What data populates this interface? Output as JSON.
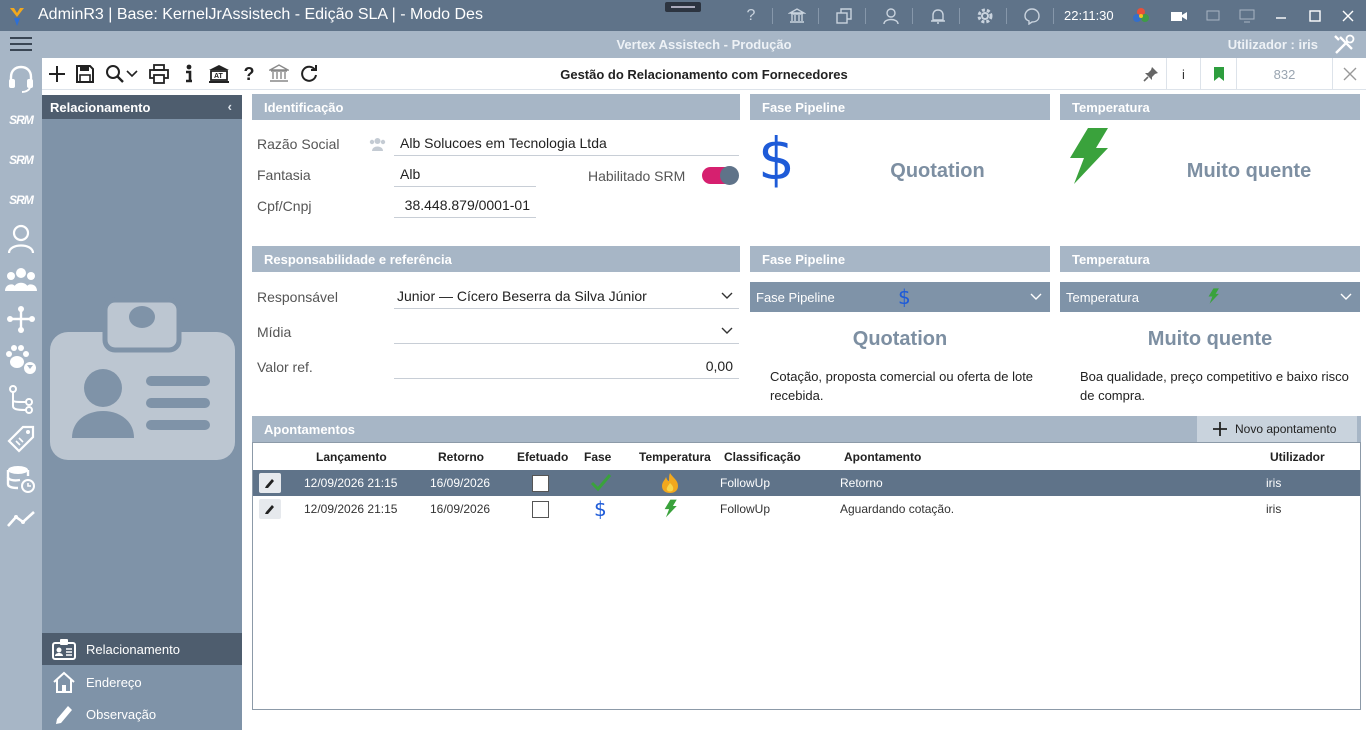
{
  "titlebar": {
    "title": "AdminR3 | Base: KernelJrAssistech - Edição SLA | - Modo Des",
    "clock": "22:11:30"
  },
  "subbar": {
    "company": "Vertex Assistech - Produção",
    "user_label": "Utilizador : iris"
  },
  "rail": {
    "srm_label": "SRM"
  },
  "toolbar": {
    "form_title": "Gestão do Relacionamento com Fornecedores",
    "info_label": "i",
    "code": "832"
  },
  "sidepanel": {
    "header": "Relacionamento",
    "nav": [
      {
        "label": "Relacionamento",
        "icon": "id-card-icon"
      },
      {
        "label": "Endereço",
        "icon": "home-icon"
      },
      {
        "label": "Observação",
        "icon": "pencil-icon"
      }
    ]
  },
  "identificacao": {
    "header": "Identificação",
    "razao_label": "Razão Social",
    "razao_value": "Alb Solucoes em Tecnologia Ltda",
    "fantasia_label": "Fantasia",
    "fantasia_value": "Alb",
    "cnpj_label": "Cpf/Cnpj",
    "cnpj_value": "38.448.879/0001-01",
    "srm_label": "Habilitado SRM",
    "srm_enabled": true
  },
  "fase_top": {
    "header": "Fase Pipeline",
    "value": "Quotation",
    "icon": "dollar-icon"
  },
  "temp_top": {
    "header": "Temperatura",
    "value": "Muito quente",
    "icon": "lightning-icon"
  },
  "responsabilidade": {
    "header": "Responsabilidade e referência",
    "responsavel_label": "Responsável",
    "responsavel_value": "Junior — Cícero Beserra da Silva Júnior",
    "midia_label": "Mídia",
    "midia_value": "",
    "valor_label": "Valor ref.",
    "valor_value": "0,00"
  },
  "fase_bottom": {
    "header": "Fase Pipeline",
    "combo_label": "Fase Pipeline",
    "value": "Quotation",
    "description": "Cotação, proposta comercial ou oferta de lote recebida."
  },
  "temp_bottom": {
    "header": "Temperatura",
    "combo_label": "Temperatura",
    "value": "Muito quente",
    "description": "Boa qualidade, preço competitivo e baixo risco de compra."
  },
  "apontamentos": {
    "header": "Apontamentos",
    "new_button": "Novo apontamento",
    "columns": [
      "Lançamento",
      "Retorno",
      "Efetuado",
      "Fase",
      "Temperatura",
      "Classificação",
      "Apontamento",
      "Utilizador"
    ],
    "rows": [
      {
        "lancamento": "12/09/2026 21:15",
        "retorno": "16/09/2026",
        "efetuado": false,
        "fase_icon": "check-icon",
        "temp_icon": "flame-icon",
        "classificacao": "FollowUp",
        "apontamento": "Retorno",
        "utilizador": "iris",
        "selected": true
      },
      {
        "lancamento": "12/09/2026 21:15",
        "retorno": "16/09/2026",
        "efetuado": false,
        "fase_icon": "dollar-icon",
        "temp_icon": "lightning-icon",
        "classificacao": "FollowUp",
        "apontamento": "Aguardando cotação.",
        "utilizador": "iris",
        "selected": false
      }
    ]
  },
  "colors": {
    "titlebar": "#5f7389",
    "bar": "#a7b6c6",
    "panel": "#7f93a8",
    "panel_dark": "#4e5d6e",
    "accent_blue": "#1e5bd8",
    "accent_green": "#3aa23c",
    "toggle": "#d6206f"
  }
}
